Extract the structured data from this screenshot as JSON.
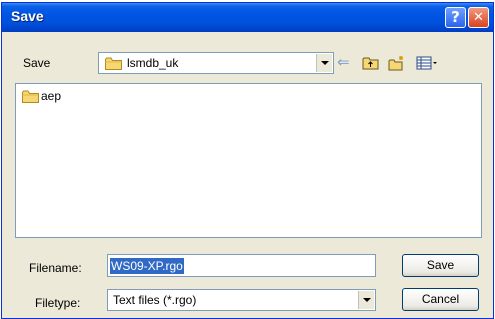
{
  "window": {
    "title": "Save",
    "help_glyph": "?",
    "close_glyph": "✕"
  },
  "location": {
    "label": "Save",
    "current_folder": "lsmdb_uk"
  },
  "toolbar": {
    "icons": [
      "back-arrow-icon",
      "up-one-level-icon",
      "new-folder-icon",
      "views-menu-icon"
    ],
    "back_glyph": "⇐"
  },
  "files": [
    {
      "name": "aep",
      "icon": "folder-icon"
    }
  ],
  "filename": {
    "label": "Filename:",
    "value": "WS09-XP.rgo"
  },
  "filetype": {
    "label": "Filetype:",
    "value": "Text files (*.rgo)"
  },
  "buttons": {
    "save": "Save",
    "cancel": "Cancel"
  },
  "colors": {
    "titlebar": "#0054e3",
    "selection": "#316ac5",
    "dialog_bg": "#ece9d8"
  }
}
